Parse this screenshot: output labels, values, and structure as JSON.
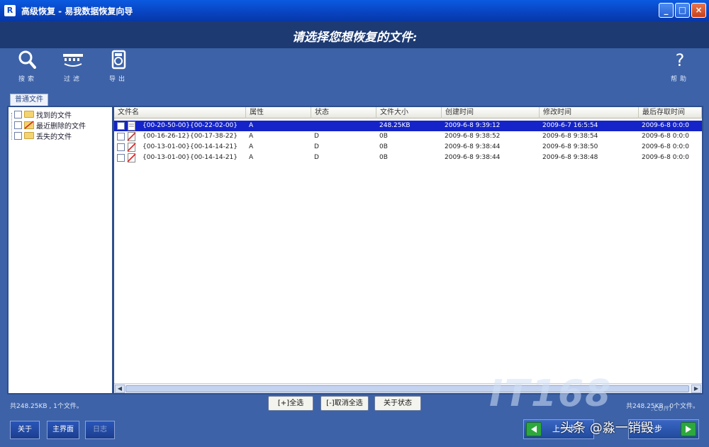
{
  "window": {
    "app_logo": "R",
    "title": "高级恢复  -  易我数据恢复向导",
    "controls": {
      "minimize": "_",
      "maximize": "□",
      "close": "×"
    }
  },
  "banner": {
    "title": "请选择您想恢复的文件:"
  },
  "toolbar": {
    "search": "搜索",
    "filter": "过滤",
    "export": "导出",
    "help": "帮助"
  },
  "tab": {
    "label": "普通文件"
  },
  "tree": {
    "items": [
      {
        "label": "找到的文件"
      },
      {
        "label": "最近删除的文件"
      },
      {
        "label": "丢失的文件"
      }
    ]
  },
  "table": {
    "columns": [
      "文件名",
      "属性",
      "状态",
      "文件大小",
      "创建时间",
      "修改时间",
      "最后存取时间"
    ],
    "rows": [
      [
        "{00-20-50-00}{00-22-02-00}",
        "A",
        "",
        "248.25KB",
        "2009-6-8 9:39:12",
        "2009-6-7 16:5:54",
        "2009-6-8 0:0:0"
      ],
      [
        "{00-16-26-12}{00-17-38-22}",
        "A",
        "D",
        "0B",
        "2009-6-8 9:38:52",
        "2009-6-8 9:38:54",
        "2009-6-8 0:0:0"
      ],
      [
        "{00-13-01-00}{00-14-14-21}",
        "A",
        "D",
        "0B",
        "2009-6-8 9:38:44",
        "2009-6-8 9:38:50",
        "2009-6-8 0:0:0"
      ],
      [
        "{00-13-01-00}{00-14-14-21}",
        "A",
        "D",
        "0B",
        "2009-6-8 9:38:44",
        "2009-6-8 9:38:48",
        "2009-6-8 0:0:0"
      ]
    ],
    "selected_row": 0
  },
  "status": {
    "left": "共248.25KB , 1个文件。",
    "right": "共248.25KB , 0个文件。"
  },
  "actions": {
    "select_all": "[+]全选",
    "deselect_all": "[-]取消全选",
    "about_status": "关于状态"
  },
  "bottom": {
    "close": "关于",
    "main": "主界面",
    "log": "日志",
    "prev": "上一步",
    "next": "下一步"
  },
  "watermark": {
    "it168": "IT168",
    "com": ".com",
    "toutiao": "头条 @淼一销毁"
  }
}
